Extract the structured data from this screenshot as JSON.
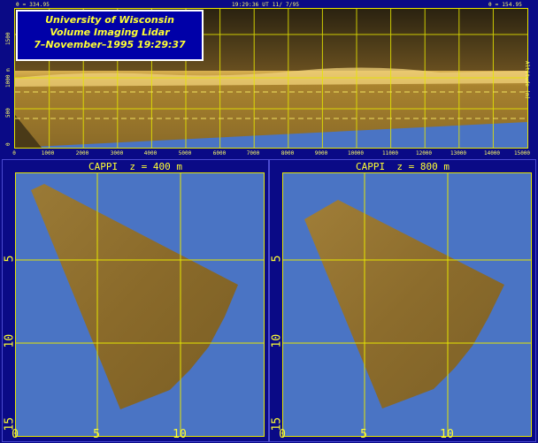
{
  "rhi": {
    "top_left": "θ = 334.95",
    "top_center": "19:29:36 UT 11/ 7/95",
    "top_right": "θ = 154.95",
    "title_lines": [
      "University of Wisconsin",
      "Volume Imaging Lidar",
      "7–November–1995 19:29:37"
    ],
    "y_ticks": [
      "0",
      "500",
      "1000 m",
      "1500"
    ],
    "x_ticks": [
      "0",
      "1000",
      "2000",
      "3000",
      "4000",
      "5000",
      "6000",
      "7000",
      "8000",
      "9000",
      "10000",
      "11000",
      "12000",
      "13000",
      "14000",
      "15000"
    ],
    "right_label": "Altitude (m)"
  },
  "cappi_left": {
    "title": "CAPPI  z = 400 m",
    "y_ticks": [
      "5",
      "10",
      "15"
    ],
    "x_ticks": [
      "0",
      "5",
      "10"
    ]
  },
  "cappi_right": {
    "title": "CAPPI  z = 800 m",
    "y_ticks": [
      "5",
      "10",
      "15"
    ],
    "x_ticks": [
      "0",
      "5",
      "10"
    ]
  },
  "colors": {
    "background": "#0a0a86",
    "sky_blue": "#4a74c4",
    "grid": "#e6e600",
    "lidar_tan": "#8a6a28"
  }
}
